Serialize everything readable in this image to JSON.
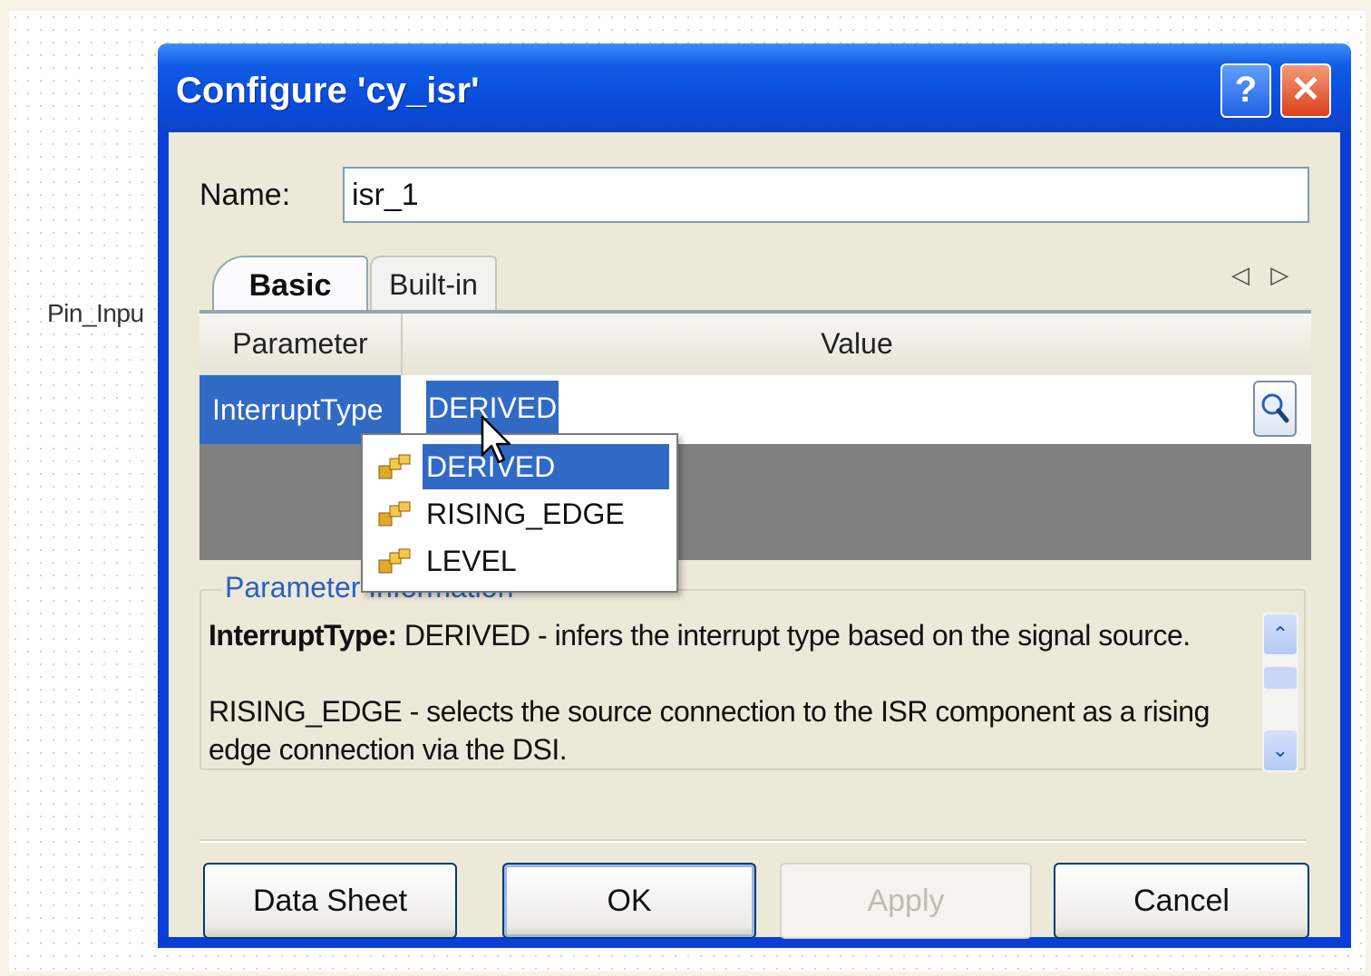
{
  "background": {
    "pin_label": "Pin_Inpu"
  },
  "dialog": {
    "title": "Configure 'cy_isr'",
    "help_label": "?",
    "close_label": "✕",
    "name_label": "Name:",
    "name_value": "isr_1",
    "tabs": [
      {
        "label": "Basic",
        "selected": true
      },
      {
        "label": "Built-in",
        "selected": false
      }
    ],
    "tab_scroll_arrows": "◁ ▷",
    "grid": {
      "columns": [
        "Parameter",
        "Value"
      ],
      "rows": [
        {
          "parameter": "InterruptType",
          "value": "DERIVED"
        }
      ]
    },
    "dropdown": {
      "options": [
        {
          "label": "DERIVED",
          "selected": true
        },
        {
          "label": "RISING_EDGE",
          "selected": false
        },
        {
          "label": "LEVEL",
          "selected": false
        }
      ]
    },
    "parameter_info": {
      "legend": "Parameter Information",
      "term": "InterruptType:",
      "line1": "DERIVED - infers the interrupt type based on the signal source.",
      "line2": "RISING_EDGE - selects the source connection to the ISR component as a rising edge connection via the DSI."
    },
    "buttons": {
      "datasheet": "Data Sheet",
      "ok": "OK",
      "apply": "Apply",
      "cancel": "Cancel"
    },
    "apply_enabled": false
  },
  "colors": {
    "title_bar": "#0a4ad8",
    "selection": "#316ac5",
    "dialog_bg": "#ece9d8"
  },
  "icons": {
    "dropdown_item": "component-icon",
    "value_browse": "magnifier-icon"
  }
}
